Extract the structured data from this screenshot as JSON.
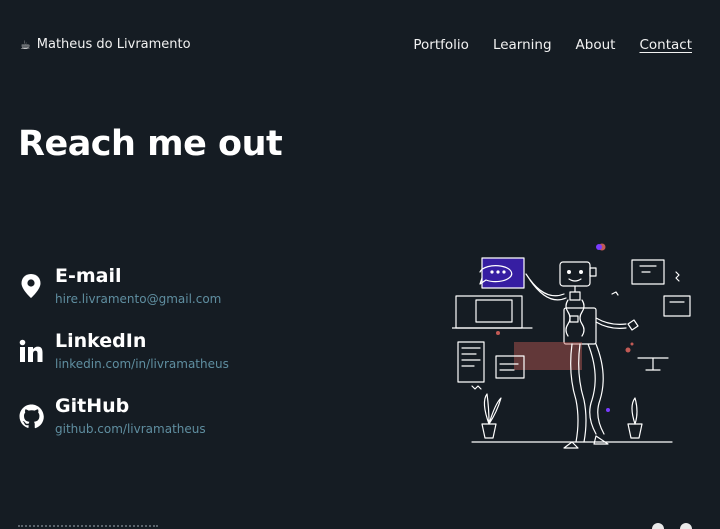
{
  "header": {
    "brand_icon": "coffee-icon",
    "brand_name": "Matheus do Livramento",
    "nav": [
      {
        "label": "Portfolio"
      },
      {
        "label": "Learning"
      },
      {
        "label": "About"
      },
      {
        "label": "Contact",
        "active": true
      }
    ]
  },
  "main": {
    "title": "Reach me out",
    "contacts": [
      {
        "icon": "location-pin-icon",
        "title": "E-mail",
        "link": "hire.livramento@gmail.com"
      },
      {
        "icon": "linkedin-icon",
        "title": "LinkedIn",
        "link": "linkedin.com/in/livramatheus"
      },
      {
        "icon": "github-icon",
        "title": "GitHub",
        "link": "github.com/livramatheus"
      }
    ]
  },
  "colors": {
    "background": "#151c23",
    "link": "#5f8ea0",
    "accent_purple": "#3a1fb0",
    "accent_red": "#c25a55"
  }
}
